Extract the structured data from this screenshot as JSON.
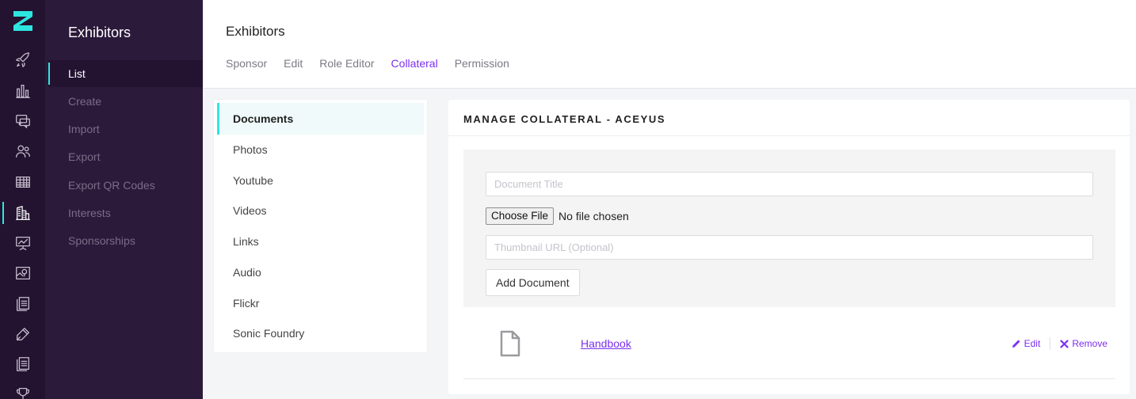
{
  "sidebar": {
    "title": "Exhibitors",
    "items": [
      {
        "label": "List",
        "active": true
      },
      {
        "label": "Create"
      },
      {
        "label": "Import"
      },
      {
        "label": "Export"
      },
      {
        "label": "Export QR Codes"
      },
      {
        "label": "Interests"
      },
      {
        "label": "Sponsorships"
      }
    ]
  },
  "rail_icons": [
    "rocket-icon",
    "bar-chart-icon",
    "chat-icon",
    "people-icon",
    "table-icon",
    "building-icon",
    "presentation-icon",
    "map-icon",
    "document-icon",
    "pen-icon",
    "pages-icon",
    "trophy-icon"
  ],
  "header": {
    "title": "Exhibitors",
    "tabs": [
      {
        "label": "Sponsor"
      },
      {
        "label": "Edit"
      },
      {
        "label": "Role Editor"
      },
      {
        "label": "Collateral",
        "active": true
      },
      {
        "label": "Permission"
      }
    ]
  },
  "collateral_types": [
    {
      "label": "Documents",
      "active": true
    },
    {
      "label": "Photos"
    },
    {
      "label": "Youtube"
    },
    {
      "label": "Videos"
    },
    {
      "label": "Links"
    },
    {
      "label": "Audio"
    },
    {
      "label": "Flickr"
    },
    {
      "label": "Sonic Foundry"
    }
  ],
  "panel": {
    "title": "MANAGE COLLATERAL - ACEYUS",
    "form": {
      "title_placeholder": "Document Title",
      "file_button": "Choose File",
      "file_status": "No file chosen",
      "thumbnail_placeholder": "Thumbnail URL (Optional)",
      "add_button": "Add Document"
    },
    "documents": [
      {
        "name": "Handbook",
        "edit_label": "Edit",
        "remove_label": "Remove"
      }
    ]
  },
  "colors": {
    "accent": "#7b2ff0",
    "teal": "#2ee6e0",
    "rail_bg": "#231330",
    "subnav_bg": "#2c1a3b"
  }
}
